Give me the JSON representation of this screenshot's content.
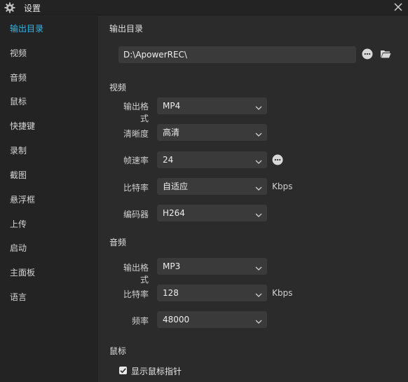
{
  "window": {
    "title": "设置",
    "icon": "gear-icon",
    "close_icon": "close-icon"
  },
  "sidebar": {
    "items": [
      {
        "label": "输出目录",
        "active": true
      },
      {
        "label": "视频"
      },
      {
        "label": "音频"
      },
      {
        "label": "鼠标"
      },
      {
        "label": "快捷键"
      },
      {
        "label": "录制"
      },
      {
        "label": "截图"
      },
      {
        "label": "悬浮框"
      },
      {
        "label": "上传"
      },
      {
        "label": "启动"
      },
      {
        "label": "主面板"
      },
      {
        "label": "语言"
      }
    ]
  },
  "output_dir": {
    "heading": "输出目录",
    "path": "D:\\ApowerREC\\",
    "more_icon": "more-icon",
    "folder_icon": "folder-icon"
  },
  "video": {
    "heading": "视频",
    "format_label": "输出格式",
    "format_value": "MP4",
    "quality_label": "清晰度",
    "quality_value": "高清",
    "fps_label": "帧速率",
    "fps_value": "24",
    "bitrate_label": "比特率",
    "bitrate_value": "自适应",
    "bitrate_unit": "Kbps",
    "encoder_label": "编码器",
    "encoder_value": "H264"
  },
  "audio": {
    "heading": "音频",
    "format_label": "输出格式",
    "format_value": "MP3",
    "bitrate_label": "比特率",
    "bitrate_value": "128",
    "bitrate_unit": "Kbps",
    "samplerate_label": "频率",
    "samplerate_value": "48000"
  },
  "mouse": {
    "heading": "鼠标",
    "show_pointer_label": "显示鼠标指针",
    "show_pointer_checked": true
  },
  "colors": {
    "accent": "#2fb8e8",
    "background": "#2b2b2b",
    "sidebar": "#232323",
    "field": "#3a3a3a"
  }
}
